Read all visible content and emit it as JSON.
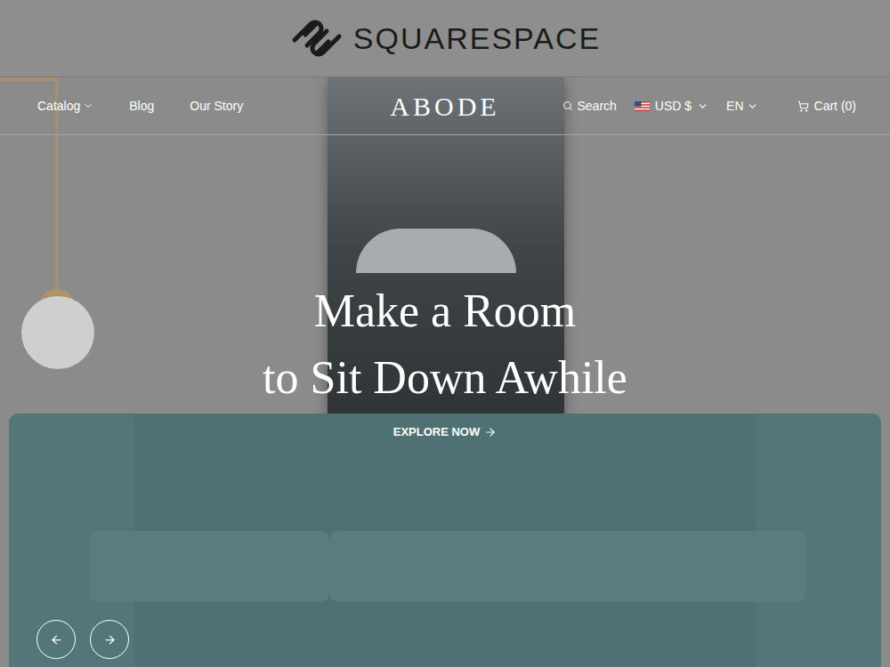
{
  "brand": {
    "name": "SQUARESPACE"
  },
  "nav": {
    "left": [
      {
        "label": "Catalog",
        "dropdown": true
      },
      {
        "label": "Blog",
        "dropdown": false
      },
      {
        "label": "Our Story",
        "dropdown": false
      }
    ],
    "logo": "ABODE",
    "right": {
      "search": "Search",
      "currency": "USD $",
      "language": "EN",
      "cart": "Cart (0)"
    }
  },
  "hero": {
    "title_lines": [
      "Make a Room",
      "to Sit Down Awhile"
    ],
    "cta": "EXPLORE NOW"
  }
}
